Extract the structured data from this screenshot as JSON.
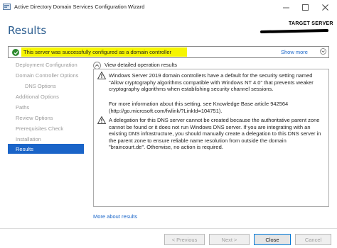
{
  "window": {
    "title": "Active Directory Domain Services Configuration Wizard",
    "icons": [
      "app-icon",
      "minimize-icon",
      "maximize-icon",
      "close-icon"
    ]
  },
  "header": {
    "page_title": "Results",
    "target_label": "TARGET SERVER"
  },
  "status": {
    "message": "This server was successfully configured as a domain controller",
    "show_more": "Show more",
    "status_color": "#2e8b2e",
    "highlight_color": "#f6f500"
  },
  "sidebar": {
    "items": [
      {
        "label": "Deployment Configuration",
        "state": "disabled"
      },
      {
        "label": "Domain Controller Options",
        "state": "disabled"
      },
      {
        "label": "DNS Options",
        "state": "disabled"
      },
      {
        "label": "Additional Options",
        "state": "disabled"
      },
      {
        "label": "Paths",
        "state": "disabled"
      },
      {
        "label": "Review Options",
        "state": "disabled"
      },
      {
        "label": "Prerequisites Check",
        "state": "disabled"
      },
      {
        "label": "Installation",
        "state": "disabled"
      },
      {
        "label": "Results",
        "state": "active"
      }
    ],
    "active_color": "#1a64c8"
  },
  "main": {
    "view_operation_results": "View detailed operation results",
    "messages": [
      {
        "type": "warning",
        "text": "Windows Server 2019 domain controllers have a default for the security setting named \"Allow cryptography algorithms compatible with Windows NT 4.0\" that prevents weaker cryptography algorithms when establishing security channel sessions."
      },
      {
        "type": "info",
        "text": "For more information about this setting, see Knowledge Base article 942564 (http://go.microsoft.com/fwlink/?LinkId=104751)."
      },
      {
        "type": "warning",
        "text": "A delegation for this DNS server cannot be created because the authoritative parent zone cannot be found or it does not run Windows DNS server. If you are integrating with an existing DNS infrastructure, you should manually create a delegation to this DNS server in the parent zone to ensure reliable name resolution from outside the domain \"braincourt.de\". Otherwise, no action is required."
      }
    ],
    "more_about": "More about results"
  },
  "buttons": {
    "previous": "< Previous",
    "next": "Next >",
    "close": "Close",
    "cancel": "Cancel"
  }
}
